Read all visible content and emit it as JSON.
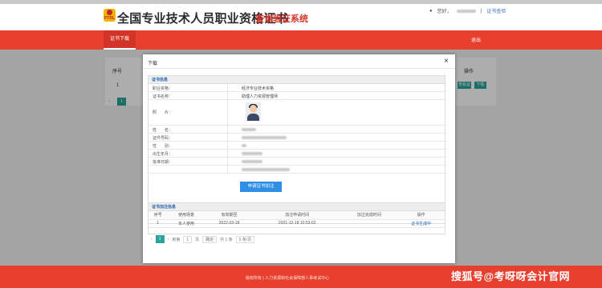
{
  "header": {
    "logo_text": "PTRL",
    "title_main": "全国专业技术人员职业资格证书",
    "title_sub": "查询验证系统",
    "user_greeting": "您好，",
    "user_name_redacted": "",
    "logout_separator": "|",
    "cert_query_link": "证书查验"
  },
  "nav": {
    "tab_download": "证书下载",
    "exit": "退出"
  },
  "background_table": {
    "col_index": "序号",
    "col_action": "操作",
    "row_index": "1",
    "btn_view": "查看证书",
    "btn_download": "下载",
    "page": "1",
    "prev": "‹"
  },
  "modal": {
    "title": "下载",
    "close": "×",
    "cert_section": "证书信息",
    "fields": [
      {
        "label": "职业资格：",
        "value": "经济专业技术资格"
      },
      {
        "label": "证书名称：",
        "value": "助理人力资源管理师"
      },
      {
        "label": "照　　片：",
        "value": ""
      },
      {
        "label": "姓　　名：",
        "value": ""
      },
      {
        "label": "证件号码：",
        "value": ""
      },
      {
        "label": "性　　别：",
        "value": ""
      },
      {
        "label": "出生年月：",
        "value": ""
      },
      {
        "label": "批准日期：",
        "value": ""
      },
      {
        "label": "",
        "value": ""
      }
    ],
    "apply_button": "申请证书加注",
    "records_section": "证书加注信息",
    "records_headers": [
      "序号",
      "使用场景",
      "有效期至",
      "加注申请时间",
      "加注完成时间",
      "操作"
    ],
    "records_rows": [
      [
        "1",
        "本人使用",
        "2022-03-18",
        "2021-12-18 10:53:02",
        "",
        "证书生成中"
      ]
    ],
    "pager": {
      "prev": "‹",
      "current": "1",
      "next": "›",
      "goto": "到第",
      "goto_value": "1",
      "page_unit": "页",
      "confirm": "确定",
      "total": "共 1 条",
      "per_page": "5 条/页"
    }
  },
  "footer": {
    "text": "版权所有 | 人力资源和社会保障部人事考试中心",
    "watermark": "搜狐号@考呀呀会计官网"
  }
}
